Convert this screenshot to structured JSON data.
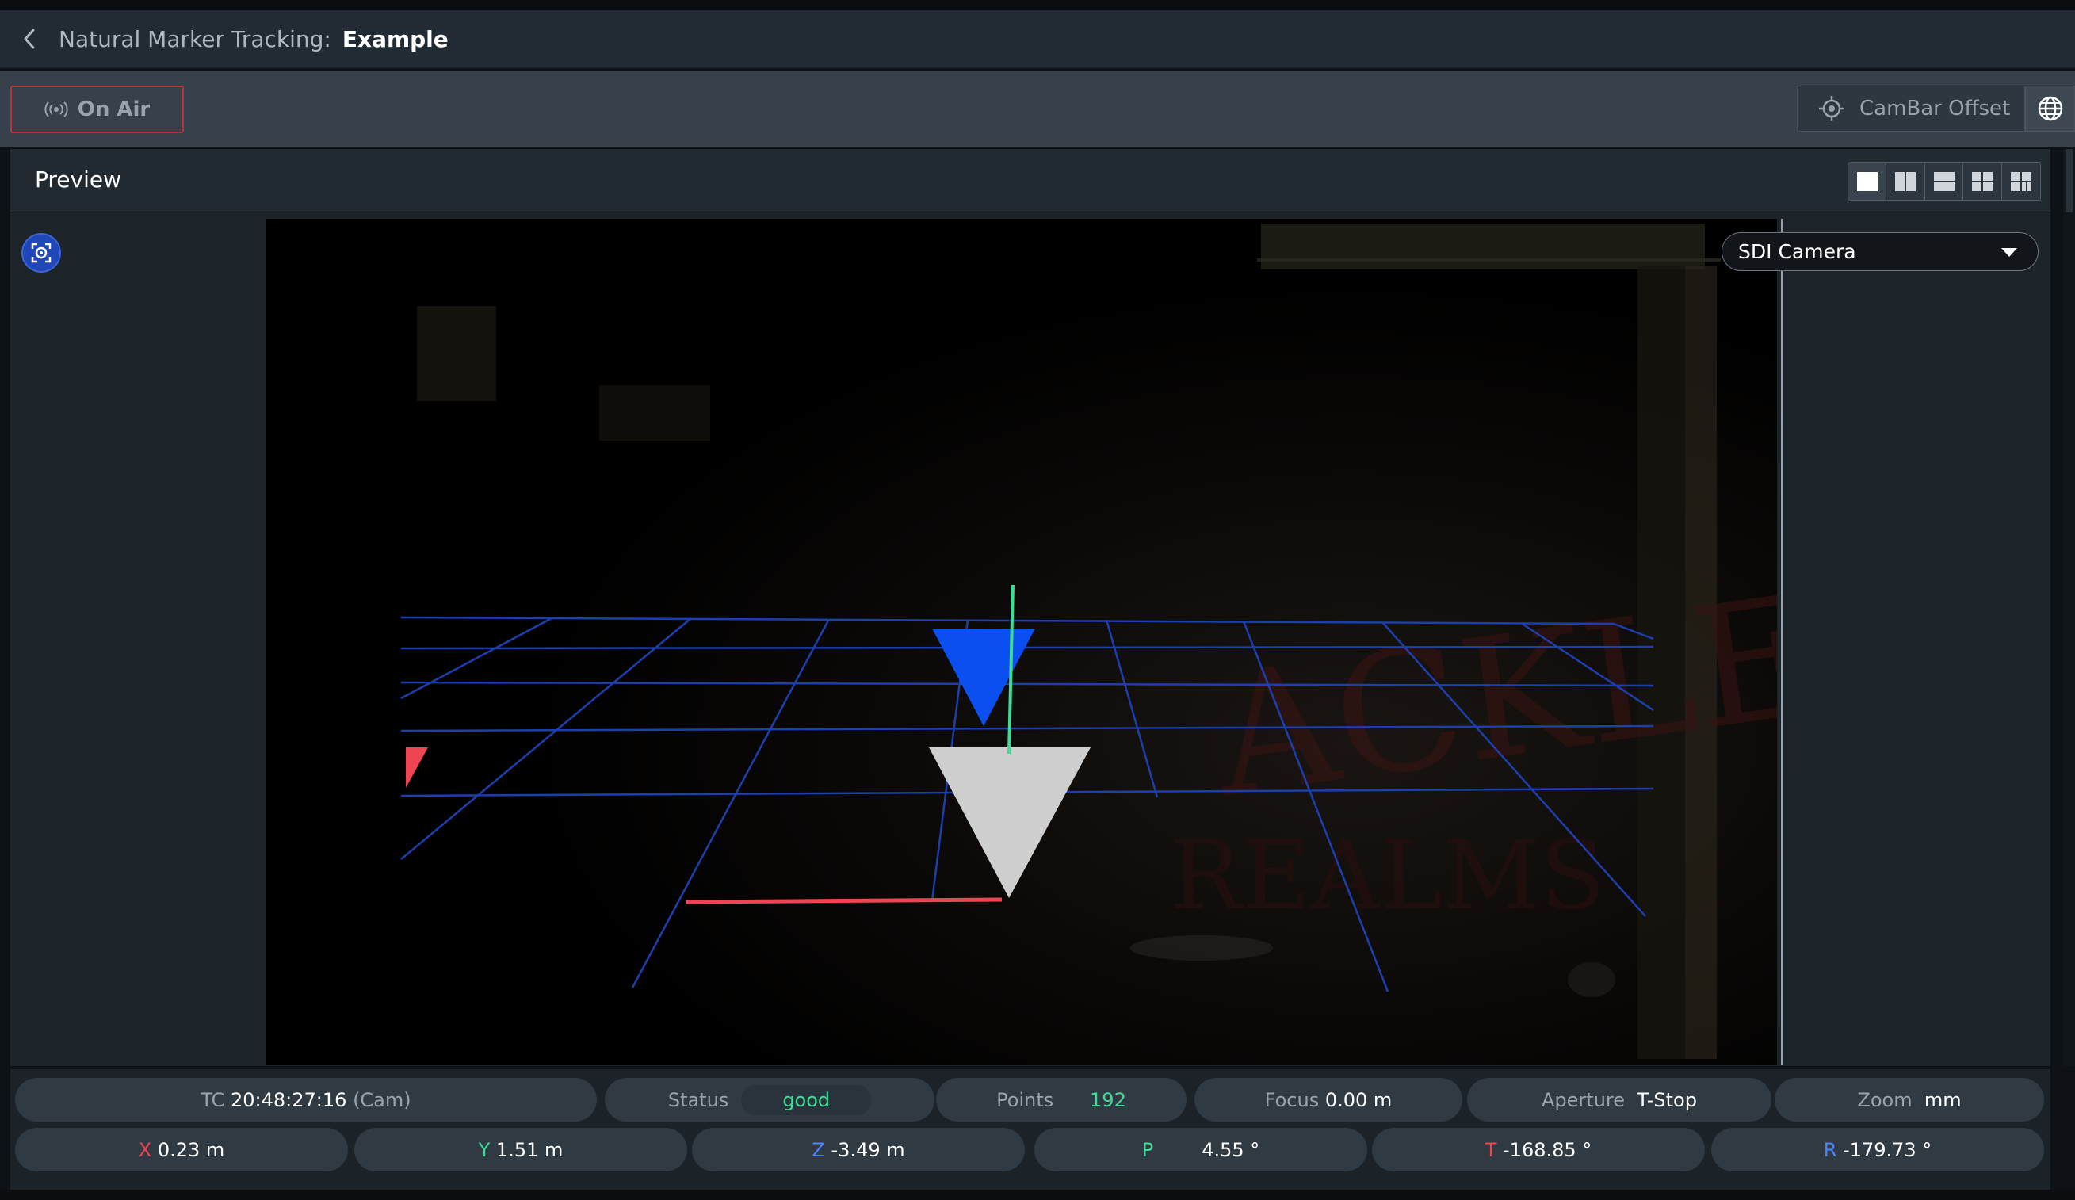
{
  "header": {
    "module": "Natural Marker Tracking:",
    "project": "Example"
  },
  "toolbar": {
    "on_air_label": "On Air",
    "cambar_label": "CamBar Offset"
  },
  "preview": {
    "title": "Preview",
    "camera_select": "SDI Camera",
    "layouts": [
      "single",
      "split-vertical",
      "split-horizontal",
      "quad",
      "grid"
    ]
  },
  "status": {
    "tc_label": "TC",
    "tc_value": "20:48:27:16",
    "tc_source": "(Cam)",
    "status_label": "Status",
    "status_value": "good",
    "points_label": "Points",
    "points_value": "192",
    "focus_label": "Focus",
    "focus_value": "0.00 m",
    "aperture_label": "Aperture",
    "aperture_value": "T-Stop",
    "zoom_label": "Zoom",
    "zoom_value": "mm"
  },
  "pose": {
    "x_label": "X",
    "x_value": "0.23 m",
    "y_label": "Y",
    "y_value": "1.51 m",
    "z_label": "Z",
    "z_value": "-3.49 m",
    "p_label": "P",
    "p_value": "4.55 °",
    "t_label": "T",
    "t_value": "-168.85 °",
    "r_label": "R",
    "r_value": "-179.73 °"
  },
  "colors": {
    "accent_blue": "#1f47b8",
    "good_green": "#3ddc97",
    "axis_red": "#ef4452",
    "on_air_border": "#b8333a"
  }
}
